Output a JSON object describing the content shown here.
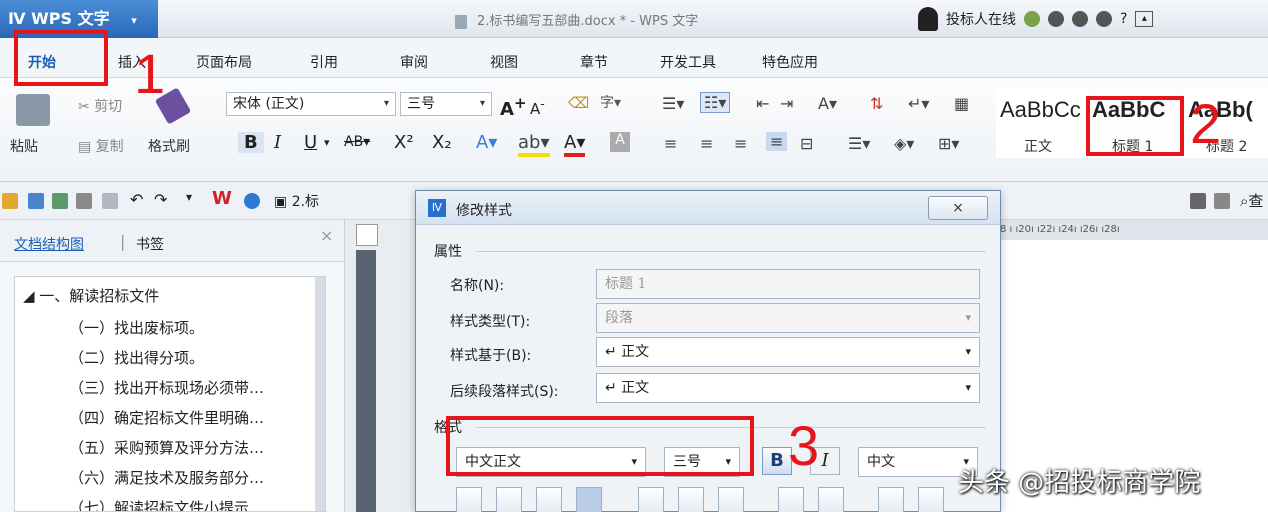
{
  "app": {
    "logo_text": "WPS 文字",
    "logo_dropdown": "▾",
    "window_title": "2.标书编写五部曲.docx * - WPS 文字",
    "user_status": "投标人在线",
    "help_label": "?"
  },
  "menu": {
    "items": [
      "开始",
      "插入",
      "页面布局",
      "引用",
      "审阅",
      "视图",
      "章节",
      "开发工具",
      "特色应用"
    ]
  },
  "ribbon": {
    "paste_label": "粘贴",
    "cut_label": "剪切",
    "copy_label": "复制",
    "format_painter_label": "格式刷",
    "font_name": "宋体 (正文)",
    "font_size": "三号",
    "bold": "B",
    "italic": "I",
    "underline": "U",
    "styles": [
      {
        "sample": "AaBbCc",
        "label": "正文"
      },
      {
        "sample": "AaBbC",
        "label": "标题 1"
      },
      {
        "sample": "AaBb(",
        "label": "标题 2"
      }
    ]
  },
  "quick_access": {
    "doc_tab": "2.标"
  },
  "sidepanel": {
    "tab_structure": "文档结构图",
    "tab_bookmark": "书签",
    "tree": [
      "◢ 一、解读招标文件",
      "（一）找出废标项。",
      "（二）找出得分项。",
      "（三）找出开标现场必须带…",
      "（四）确定招标文件里明确…",
      "（五）采购预算及评分方法…",
      "（六）满足技术及服务部分…",
      "（七）解读招标文件小提示…"
    ]
  },
  "ruler": {
    "text": "8 ı  ı20ı  ı22ı  ı24ı  ı26ı  ı28ı"
  },
  "dialog": {
    "title": "修改样式",
    "close": "⨯",
    "group_properties": "属性",
    "name_label": "名称(N):",
    "name_value": "标题 1",
    "type_label": "样式类型(T):",
    "type_value": "段落",
    "based_label": "样式基于(B):",
    "based_value": "↵ 正文",
    "next_label": "后续段落样式(S):",
    "next_value": "↵ 正文",
    "group_format": "格式",
    "font_value": "中文正文",
    "size_value": "三号",
    "bold_btn": "B",
    "italic_btn": "I",
    "lang_value": "中文"
  },
  "annotations": {
    "n1": "1",
    "n2": "2",
    "n3": "3"
  },
  "watermark": "头条 @招投标商学院"
}
